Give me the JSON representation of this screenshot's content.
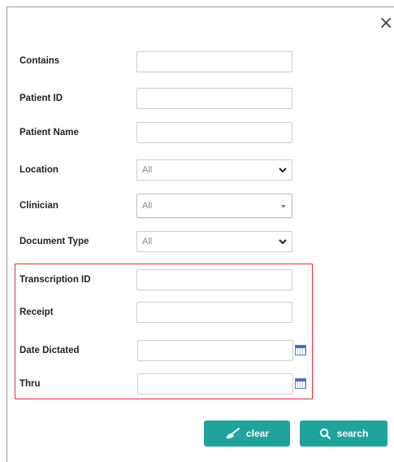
{
  "dialog": {
    "close_symbol": "×",
    "fields": {
      "contains": {
        "label": "Contains",
        "value": ""
      },
      "patient_id": {
        "label": "Patient ID",
        "value": ""
      },
      "patient_name": {
        "label": "Patient Name",
        "value": ""
      },
      "location": {
        "label": "Location",
        "value": "All"
      },
      "clinician": {
        "label": "Clinician",
        "value": "All"
      },
      "document_type": {
        "label": "Document Type",
        "value": "All"
      },
      "transcription_id": {
        "label": "Transcription ID",
        "value": ""
      },
      "receipt": {
        "label": "Receipt",
        "value": ""
      },
      "date_dictated": {
        "label": "Date Dictated",
        "value": ""
      },
      "thru": {
        "label": "Thru",
        "value": ""
      }
    },
    "buttons": {
      "clear": "clear",
      "search": "search"
    },
    "colors": {
      "accent": "#1fa39b",
      "highlight": "#e0303a"
    },
    "icons": [
      "close-icon",
      "chevron-down-icon",
      "caret-down-icon",
      "calendar-icon",
      "broom-icon",
      "search-icon"
    ]
  }
}
